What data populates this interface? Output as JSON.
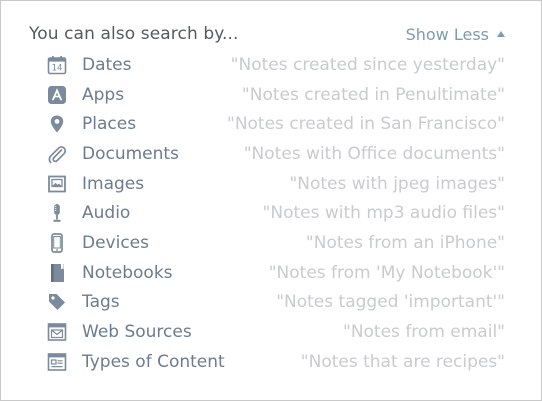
{
  "header": {
    "title": "You can also search by...",
    "toggle_label": "Show Less"
  },
  "rows": [
    {
      "icon": "calendar-icon",
      "label": "Dates",
      "example": "\"Notes created since yesterday\""
    },
    {
      "icon": "app-store-icon",
      "label": "Apps",
      "example": "\"Notes created in Penultimate\""
    },
    {
      "icon": "location-pin-icon",
      "label": "Places",
      "example": "\"Notes created in San Francisco\""
    },
    {
      "icon": "paperclip-icon",
      "label": "Documents",
      "example": "\"Notes with Office documents\""
    },
    {
      "icon": "image-icon",
      "label": "Images",
      "example": "\"Notes with jpeg images\""
    },
    {
      "icon": "microphone-icon",
      "label": "Audio",
      "example": "\"Notes with mp3 audio files\""
    },
    {
      "icon": "phone-icon",
      "label": "Devices",
      "example": "\"Notes from an iPhone\""
    },
    {
      "icon": "notebook-icon",
      "label": "Notebooks",
      "example": "\"Notes from 'My Notebook'\""
    },
    {
      "icon": "tag-icon",
      "label": "Tags",
      "example": "\"Notes tagged 'important'\""
    },
    {
      "icon": "web-clip-icon",
      "label": "Web Sources",
      "example": "\"Notes from email\""
    },
    {
      "icon": "content-type-icon",
      "label": "Types of Content",
      "example": "\"Notes that are recipes\""
    }
  ],
  "colors": {
    "icon": "#7b8a9c",
    "label": "#6d7b8f",
    "example": "#c8cbcf",
    "link": "#7d9bb0",
    "title": "#555a5e"
  }
}
